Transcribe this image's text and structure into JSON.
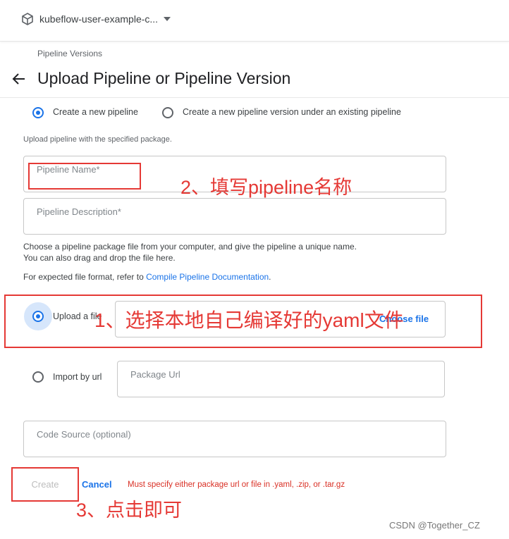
{
  "header": {
    "namespace": "kubeflow-user-example-c..."
  },
  "breadcrumb": "Pipeline Versions",
  "page_title": "Upload Pipeline or Pipeline Version",
  "mode": {
    "new_pipeline": "Create a new pipeline",
    "new_version": "Create a new pipeline version under an existing pipeline"
  },
  "hint": "Upload pipeline with the specified package.",
  "fields": {
    "name_placeholder": "Pipeline Name*",
    "description_placeholder": "Pipeline Description*",
    "package_url_placeholder": "Package Url",
    "code_source_placeholder": "Code Source (optional)"
  },
  "help": {
    "line1": "Choose a pipeline package file from your computer, and give the pipeline a unique name.",
    "line2": "You can also drag and drop the file here.",
    "format_prefix": "For expected file format, refer to ",
    "format_link": "Compile Pipeline Documentation",
    "format_suffix": "."
  },
  "source": {
    "upload_file": "Upload a file",
    "choose_file": "Choose file",
    "import_url": "Import by url"
  },
  "actions": {
    "create": "Create",
    "cancel": "Cancel",
    "error": "Must specify either package url or file in .yaml, .zip, or .tar.gz"
  },
  "annotations": {
    "step1": "1、选择本地自己编译好的yaml文件",
    "step2": "2、填写pipeline名称",
    "step3": "3、点击即可"
  },
  "watermark": "CSDN @Together_CZ",
  "colors": {
    "accent": "#1a73e8",
    "error": "#d93025",
    "annotation": "#e53935"
  }
}
